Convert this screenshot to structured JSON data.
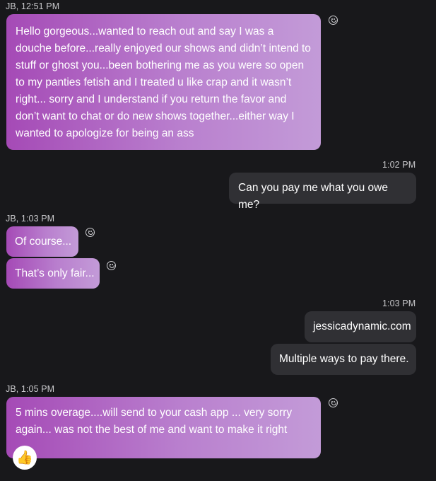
{
  "messages": {
    "m1": {
      "header": "JB, 12:51 PM",
      "text": "Hello gorgeous...wanted to reach out and say I was a douche before...really enjoyed our shows and didn’t intend to stuff or ghost you...been bothering me as you were so open to my panties fetish and I treated u like crap and it wasn’t right... sorry and I understand if you return the favor and don’t want to chat or do new shows together...either way I wanted to apologize for being an ass"
    },
    "m2": {
      "time": "1:02 PM",
      "text": "Can you pay me what you owe me?"
    },
    "m3": {
      "header": "JB, 1:03 PM",
      "text_a": "Of course...",
      "text_b": "That’s only fair..."
    },
    "m4": {
      "time": "1:03 PM",
      "text_a": "jessicadynamic.com",
      "text_b": "Multiple ways to pay there."
    },
    "m5": {
      "header": "JB, 1:05 PM",
      "text": "5 mins overage....will send to your cash app ... very sorry again... was not the best of me and want to make it right",
      "reaction": "thumbs-up"
    }
  },
  "icons": {
    "react": "smiley-reaction-icon",
    "reaction_badge": "thumbs-up-icon"
  },
  "colors": {
    "background": "#18181b",
    "incoming_gradient_start": "#a54ab6",
    "incoming_gradient_end": "#c39bd8",
    "outgoing_bubble": "#303034",
    "meta_text": "#c9c9cc"
  }
}
